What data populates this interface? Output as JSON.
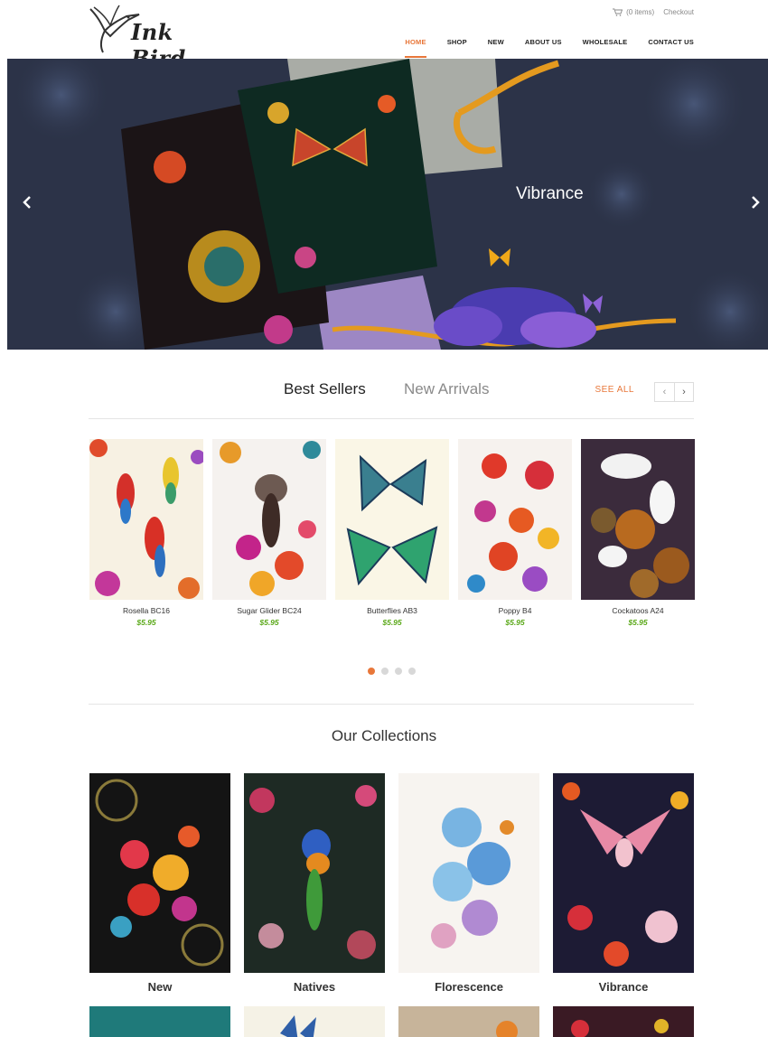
{
  "brand": {
    "name": "Ink Bird"
  },
  "topbar": {
    "cart": "(0 items)",
    "checkout": "Checkout"
  },
  "nav": [
    "HOME",
    "SHOP",
    "NEW",
    "ABOUT US",
    "WHOLESALE",
    "CONTACT US"
  ],
  "hero": {
    "title": "Vibrance"
  },
  "tabs": {
    "best": "Best Sellers",
    "new": "New Arrivals",
    "see_all": "SEE ALL"
  },
  "products": [
    {
      "name": "Rosella BC16",
      "price": "$5.95"
    },
    {
      "name": "Sugar Glider BC24",
      "price": "$5.95"
    },
    {
      "name": "Butterflies AB3",
      "price": "$5.95"
    },
    {
      "name": "Poppy B4",
      "price": "$5.95"
    },
    {
      "name": "Cockatoos A24",
      "price": "$5.95"
    }
  ],
  "collections_title": "Our Collections",
  "collections": [
    "New",
    "Natives",
    "Florescence",
    "Vibrance"
  ],
  "colors": {
    "accent": "#e8773a",
    "price": "#5aa818",
    "hero_bg": "#2b3246"
  }
}
